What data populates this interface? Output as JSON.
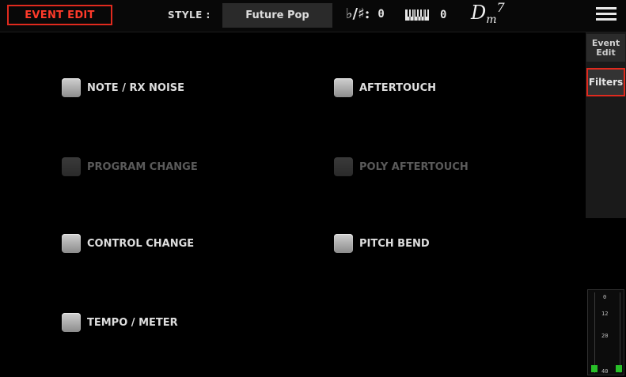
{
  "header": {
    "page_title": "EVENT EDIT",
    "style_label": "STYLE :",
    "style_name": "Future Pop",
    "key_signature_symbol": "♭/♯:",
    "key_signature_value": "0",
    "transpose_value": "0",
    "chord_root": "D",
    "chord_quality": "m",
    "chord_extension": "7"
  },
  "sidebar": {
    "tabs": [
      {
        "label": "Event Edit",
        "selected": false
      },
      {
        "label": "Filters",
        "selected": true
      }
    ]
  },
  "filters": [
    {
      "label": "NOTE / RX NOISE",
      "enabled": true
    },
    {
      "label": "AFTERTOUCH",
      "enabled": true
    },
    {
      "label": "PROGRAM CHANGE",
      "enabled": false
    },
    {
      "label": "POLY AFTERTOUCH",
      "enabled": false
    },
    {
      "label": "CONTROL CHANGE",
      "enabled": true
    },
    {
      "label": "PITCH BEND",
      "enabled": true
    },
    {
      "label": "TEMPO / METER",
      "enabled": true
    }
  ],
  "meter": {
    "ticks": [
      "0",
      "12",
      "20",
      "40"
    ]
  },
  "colors": {
    "accent": "#e02a1e",
    "meter_green": "#28c028"
  }
}
